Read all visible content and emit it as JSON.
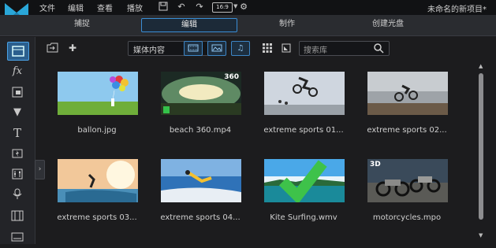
{
  "menubar": {
    "items": [
      "文件",
      "编辑",
      "查看",
      "播放"
    ],
    "aspect_ratio": "16:9",
    "project_title": "未命名的新项目*"
  },
  "modes": {
    "tabs": [
      "捕捉",
      "编辑",
      "制作",
      "创建光盘"
    ],
    "active": "编辑"
  },
  "toolstrip": {
    "tools": [
      "media-room-icon",
      "fx-icon",
      "pip-icon",
      "particle-icon",
      "title-icon",
      "transition-icon",
      "audio-mixing-icon",
      "voice-over-icon",
      "chapter-icon",
      "subtitle-icon"
    ]
  },
  "library": {
    "dropdown_value": "媒体内容",
    "search_placeholder": "搜索库",
    "filters": [
      "video-filter-icon",
      "image-filter-icon",
      "audio-filter-icon"
    ]
  },
  "media": [
    {
      "name": "ballon.jpg"
    },
    {
      "name": "beach 360.mp4",
      "badge": "360"
    },
    {
      "name": "extreme sports 01..."
    },
    {
      "name": "extreme sports 02..."
    },
    {
      "name": "extreme sports 03..."
    },
    {
      "name": "extreme sports 04..."
    },
    {
      "name": "Kite Surfing.wmv"
    },
    {
      "name": "motorcycles.mpo",
      "badge": "3D"
    }
  ],
  "colors": {
    "accent": "#3a8ed6",
    "background": "#1c1c1e",
    "check": "#3ec24a"
  }
}
